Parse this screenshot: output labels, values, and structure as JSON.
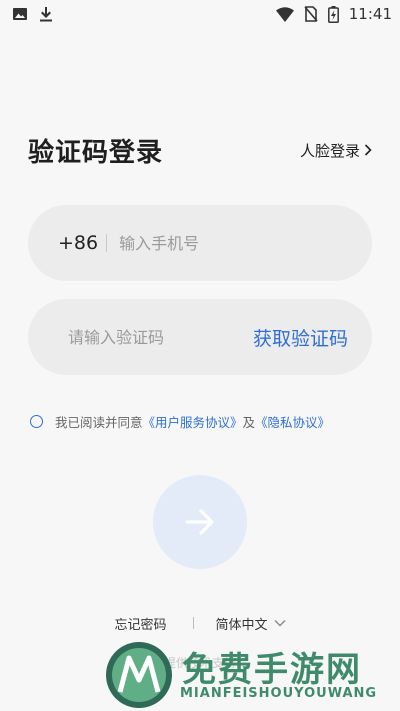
{
  "status_bar": {
    "time": "11:41",
    "icons": [
      "image-icon",
      "download-icon",
      "wifi-icon",
      "no-sim-icon",
      "battery-charging-icon"
    ]
  },
  "header": {
    "title": "验证码登录",
    "face_login": "人脸登录"
  },
  "phone_field": {
    "country_code": "+86",
    "value": "",
    "placeholder": "输入手机号"
  },
  "code_field": {
    "value": "",
    "placeholder": "请输入验证码",
    "get_code_label": "获取验证码"
  },
  "agreement": {
    "prefix": "我已阅读并同意",
    "user_agreement": "《用户服务协议》",
    "and": "及",
    "privacy": "《隐私协议》",
    "checked": false
  },
  "bottom": {
    "forgot_password": "忘记密码",
    "language": "简体中文"
  },
  "watermark": {
    "faint_text": "软件提供技术支持",
    "title": "免费手游网",
    "subtitle": "MIANFEISHOUYOUWANG"
  },
  "colors": {
    "accent": "#2f6fd3",
    "field_bg": "#ececec",
    "page_bg": "#f7f7f7",
    "submit_bg": "#e2ebf7",
    "watermark": "#3f8a6b"
  }
}
